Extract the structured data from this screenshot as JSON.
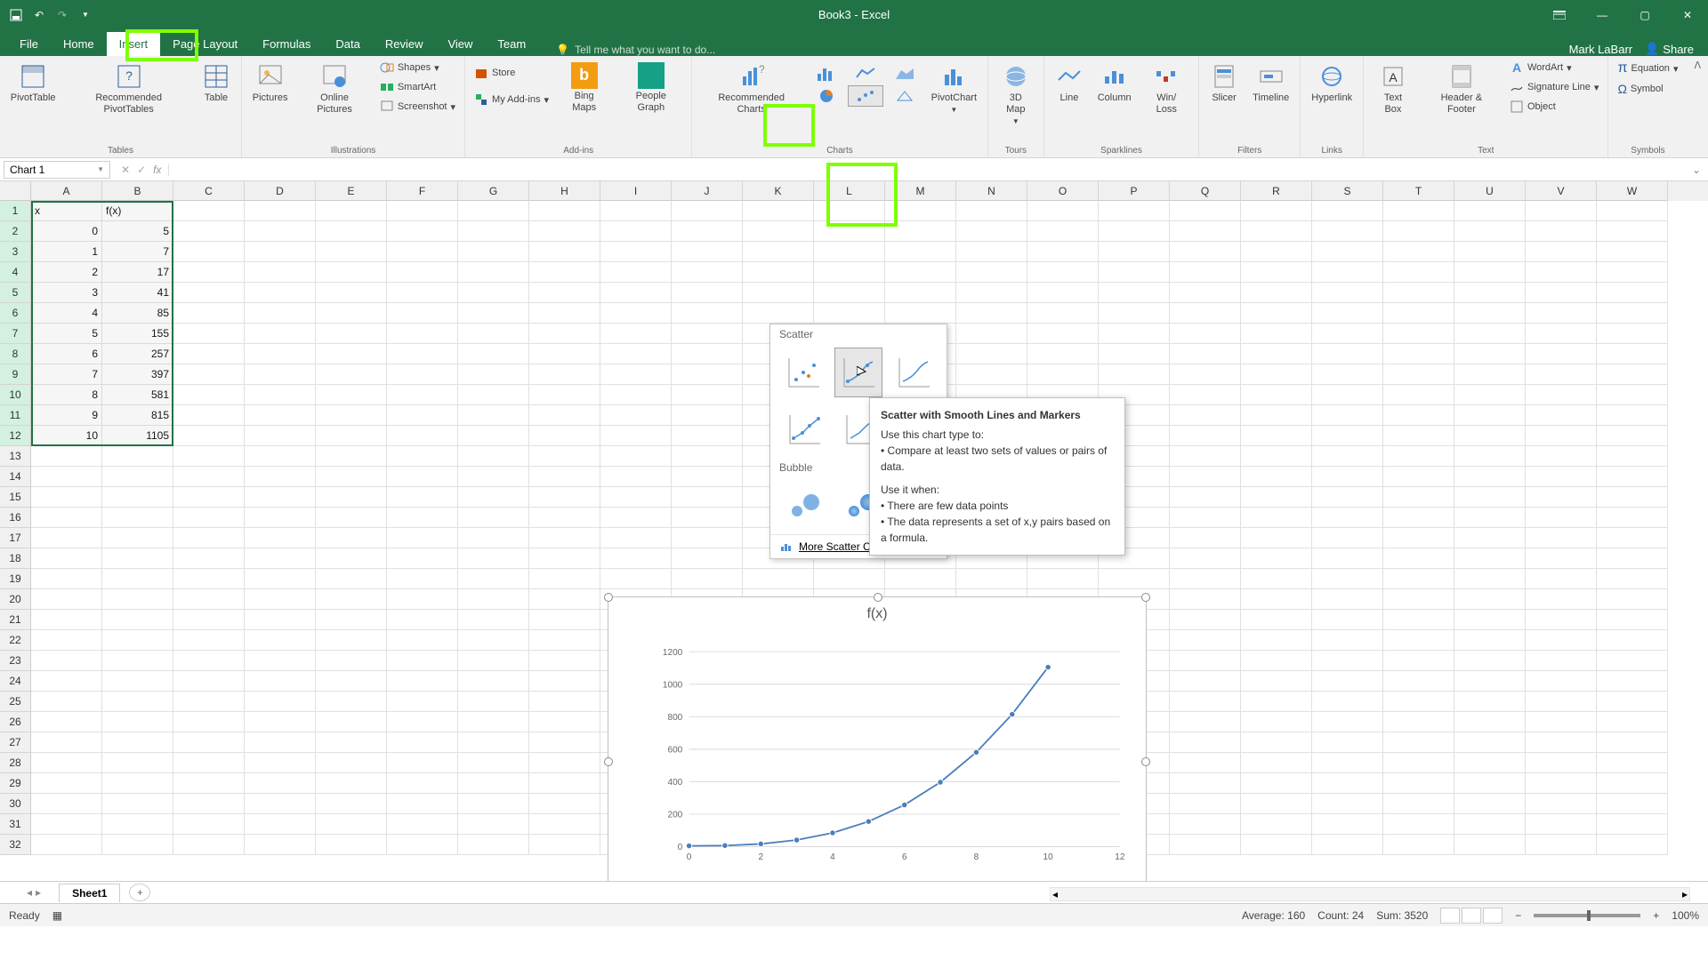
{
  "app": {
    "title": "Book3 - Excel",
    "user": "Mark LaBarr",
    "share": "Share"
  },
  "tabs": {
    "file": "File",
    "home": "Home",
    "insert": "Insert",
    "pagelayout": "Page Layout",
    "formulas": "Formulas",
    "data": "Data",
    "review": "Review",
    "view": "View",
    "team": "Team",
    "tellme": "Tell me what you want to do..."
  },
  "ribbon": {
    "tables": {
      "pivot": "PivotTable",
      "recpivot": "Recommended PivotTables",
      "table": "Table",
      "label": "Tables"
    },
    "illus": {
      "pictures": "Pictures",
      "online": "Online Pictures",
      "shapes": "Shapes",
      "smartart": "SmartArt",
      "screenshot": "Screenshot",
      "label": "Illustrations"
    },
    "addins": {
      "store": "Store",
      "myaddins": "My Add-ins",
      "bing": "Bing Maps",
      "people": "People Graph",
      "label": "Add-ins"
    },
    "charts": {
      "rec": "Recommended Charts",
      "pivotchart": "PivotChart",
      "label": "Charts"
    },
    "tours": {
      "map3d": "3D Map",
      "label": "Tours"
    },
    "spark": {
      "line": "Line",
      "column": "Column",
      "winloss": "Win/ Loss",
      "label": "Sparklines"
    },
    "filters": {
      "slicer": "Slicer",
      "timeline": "Timeline",
      "label": "Filters"
    },
    "links": {
      "hyperlink": "Hyperlink",
      "label": "Links"
    },
    "text": {
      "textbox": "Text Box",
      "headerfooter": "Header & Footer",
      "wordart": "WordArt",
      "sigline": "Signature Line",
      "object": "Object",
      "label": "Text"
    },
    "symbols": {
      "equation": "Equation",
      "symbol": "Symbol",
      "label": "Symbols"
    }
  },
  "name_box": "Chart 1",
  "columns": [
    "A",
    "B",
    "C",
    "D",
    "E",
    "F",
    "G",
    "H",
    "I",
    "J",
    "K",
    "L",
    "M",
    "N",
    "O",
    "P",
    "Q",
    "R",
    "S",
    "T",
    "U",
    "V",
    "W"
  ],
  "sheet_data": {
    "headers": {
      "A": "x",
      "B": "f(x)"
    },
    "rows": [
      {
        "n": 1,
        "A": "x",
        "B": "f(x)"
      },
      {
        "n": 2,
        "A": "0",
        "B": "5"
      },
      {
        "n": 3,
        "A": "1",
        "B": "7"
      },
      {
        "n": 4,
        "A": "2",
        "B": "17"
      },
      {
        "n": 5,
        "A": "3",
        "B": "41"
      },
      {
        "n": 6,
        "A": "4",
        "B": "85"
      },
      {
        "n": 7,
        "A": "5",
        "B": "155"
      },
      {
        "n": 8,
        "A": "6",
        "B": "257"
      },
      {
        "n": 9,
        "A": "7",
        "B": "397"
      },
      {
        "n": 10,
        "A": "8",
        "B": "581"
      },
      {
        "n": 11,
        "A": "9",
        "B": "815"
      },
      {
        "n": 12,
        "A": "10",
        "B": "1105"
      }
    ],
    "blank_rows": [
      13,
      14,
      15,
      16,
      17,
      18,
      19,
      20,
      21,
      22,
      23,
      24,
      25,
      26,
      27,
      28,
      29,
      30,
      31,
      32
    ]
  },
  "scatter_dd": {
    "scatter_label": "Scatter",
    "bubble_label": "Bubble",
    "more": "More Scatter Charts..."
  },
  "tooltip": {
    "title": "Scatter with Smooth Lines and Markers",
    "line1": "Use this chart type to:",
    "b1": "• Compare at least two sets of values or pairs of data.",
    "line2": "Use it when:",
    "b2": "• There are few data points",
    "b3": "• The data represents a set of x,y pairs based on a formula."
  },
  "chart_data": {
    "type": "scatter",
    "title": "f(x)",
    "xlabel": "",
    "ylabel": "",
    "xlim": [
      0,
      12
    ],
    "ylim": [
      0,
      1200
    ],
    "xticks": [
      0,
      2,
      4,
      6,
      8,
      10,
      12
    ],
    "yticks": [
      0,
      200,
      400,
      600,
      800,
      1000,
      1200
    ],
    "series": [
      {
        "name": "f(x)",
        "x": [
          0,
          1,
          2,
          3,
          4,
          5,
          6,
          7,
          8,
          9,
          10
        ],
        "y": [
          5,
          7,
          17,
          41,
          85,
          155,
          257,
          397,
          581,
          815,
          1105
        ]
      }
    ]
  },
  "sheet_tab": "Sheet1",
  "status": {
    "ready": "Ready",
    "avg": "Average: 160",
    "count": "Count: 24",
    "sum": "Sum: 3520",
    "zoom": "100%"
  }
}
